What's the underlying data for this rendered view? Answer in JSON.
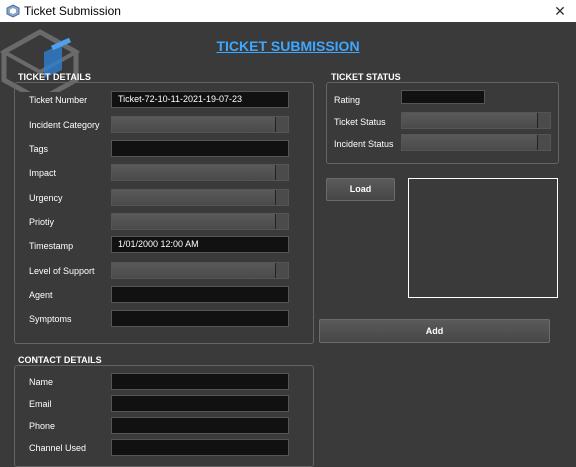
{
  "window": {
    "title": "Ticket Submission"
  },
  "header": {
    "title": "TICKET SUBMISSION"
  },
  "ticket_details": {
    "title": "TICKET DETAILS",
    "ticket_number_label": "Ticket Number",
    "ticket_number_value": "Ticket-72-10-11-2021-19-07-23",
    "incident_category_label": "Incident Category",
    "tags_label": "Tags",
    "impact_label": "Impact",
    "urgency_label": "Urgency",
    "priority_label": "Priotiy",
    "timestamp_label": "Timestamp",
    "timestamp_value": "1/01/2000 12:00 AM",
    "level_of_support_label": "Level of Support",
    "agent_label": "Agent",
    "symptoms_label": "Symptoms"
  },
  "ticket_status": {
    "title": "TICKET STATUS",
    "rating_label": "Rating",
    "ticket_status_label": "Ticket Status",
    "incident_status_label": "Incident Status"
  },
  "actions": {
    "load_label": "Load",
    "add_label": "Add"
  },
  "contact_details": {
    "title": "CONTACT DETAILS",
    "name_label": "Name",
    "email_label": "Email",
    "phone_label": "Phone",
    "channel_used_label": "Channel Used"
  }
}
